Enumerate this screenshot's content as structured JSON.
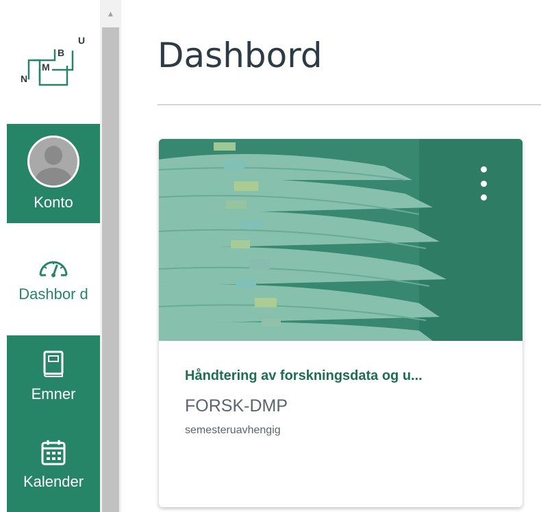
{
  "logo": {
    "letters": [
      "N",
      "M",
      "B",
      "U"
    ]
  },
  "nav": {
    "account": {
      "label": "Konto",
      "icon": "user-avatar-icon"
    },
    "dashboard": {
      "label": "Dashbor d",
      "icon": "speedometer-icon"
    },
    "courses": {
      "label": "Emner",
      "icon": "book-icon"
    },
    "calendar": {
      "label": "Kalender",
      "icon": "calendar-icon"
    }
  },
  "colors": {
    "brand": "#268566",
    "title": "#2d3b45",
    "card_title": "#1e6e53"
  },
  "page": {
    "title": "Dashbord"
  },
  "card": {
    "title": "Håndtering av forskningsdata og u...",
    "code": "FORSK-DMP",
    "term": "semesteruavhengig",
    "menu_icon": "more-vertical-icon"
  }
}
